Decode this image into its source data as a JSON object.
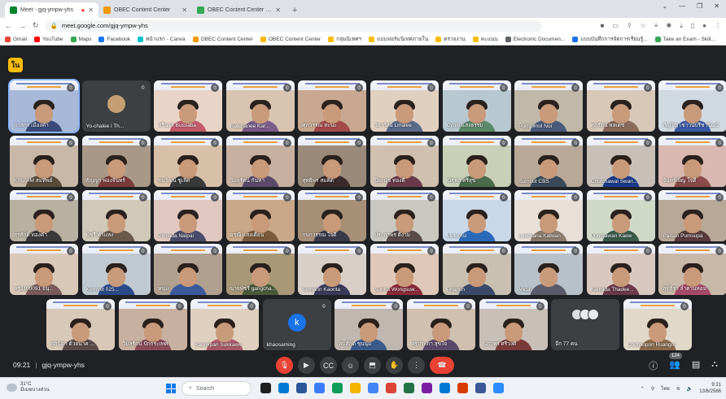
{
  "browser": {
    "tabs": [
      {
        "title": "Meet - gjq-ympw-yhs",
        "favicon_color": "#00832d",
        "active": true,
        "recording": true
      },
      {
        "title": "OBEC Content Center",
        "favicon_color": "#f29900",
        "active": false
      },
      {
        "title": "OBEC Content Center - OBEC",
        "favicon_color": "#34a853",
        "active": false
      }
    ],
    "newtab_label": "+",
    "url": "meet.google.com/gjq-ympw-yhs",
    "bookmarks": [
      {
        "label": "Gmail",
        "color": "#ea4335"
      },
      {
        "label": "YouTube",
        "color": "#ff0000"
      },
      {
        "label": "Maps",
        "color": "#34a853"
      },
      {
        "label": "Facebook",
        "color": "#1877f2"
      },
      {
        "label": "หน้าแรก - Canva",
        "color": "#00c4cc"
      },
      {
        "label": "OBEC Content Center",
        "color": "#f29900"
      },
      {
        "label": "OBEC Content Center",
        "color": "#fbbc04"
      },
      {
        "label": "กลุ่มนิเทศฯ",
        "color": "#fbbc04"
      },
      {
        "label": "แบบฟอร์มนิเทศภายใน",
        "color": "#fbbc04"
      },
      {
        "label": "ตรวจงาน",
        "color": "#fbbc04"
      },
      {
        "label": "คะแนน",
        "color": "#fbbc04"
      },
      {
        "label": "Electronic Documen...",
        "color": "#5f6368"
      },
      {
        "label": "แบบบันทึกการจัดการเรียนรู้...",
        "color": "#1a73e8"
      },
      {
        "label": "Take an Exam - Skill...",
        "color": "#34a853"
      }
    ]
  },
  "meet": {
    "host_badge": "ใน",
    "tiles": [
      {
        "name": "ภาสกร เมืองคำ",
        "kind": "video",
        "bg": "#a8b8d8",
        "body": "#3a4a7a",
        "selected": true
      },
      {
        "name": "Yo-chalee i Th...",
        "kind": "avatar",
        "bg": "#3c4043",
        "body": "#3c4043"
      },
      {
        "name": "ศรีนวล Bussaba",
        "kind": "video",
        "bg": "#e8d4c8",
        "body": "#c45a6a"
      },
      {
        "name": "Ratchanee Kar...",
        "kind": "video",
        "bg": "#d8c4b0",
        "body": "#7a5b8a"
      },
      {
        "name": "ศุภวรรณ ทะนะ",
        "kind": "video",
        "bg": "#c8a890",
        "body": "#a44a4a"
      },
      {
        "name": "วิลาวัลย์ Lmalee",
        "kind": "video",
        "bg": "#e0d0c0",
        "body": "#5a6a8a"
      },
      {
        "name": "Cynie แสงธรรม",
        "kind": "video",
        "bg": "#b8c8d0",
        "body": "#5a8a6a"
      },
      {
        "name": "Pornpimol Noi",
        "kind": "video",
        "bg": "#c0b8a8",
        "body": "#4a5a7a"
      },
      {
        "name": "ศุภรัตน์ พลเดช",
        "kind": "video",
        "bg": "#d8c8b8",
        "body": "#8a6a5a"
      },
      {
        "name": "ภิญโญ เชาวน์ปรีชาวัฒน์",
        "kind": "video",
        "bg": "#d0d8e0",
        "body": "#3a5aa8"
      },
      {
        "name": "KRU AM สมทิพย์",
        "kind": "video",
        "bg": "#c8b8a8",
        "body": "#5a4a3a"
      },
      {
        "name": "ธัญญา ฟองจันทร์",
        "kind": "video",
        "bg": "#a89888",
        "body": "#7a3a3a"
      },
      {
        "name": "ธนวัฒน์ ชูเลิศ",
        "kind": "video",
        "bg": "#d8c0a8",
        "body": "#3a3a3a"
      },
      {
        "name": "วิมลรัตน์ กันทา",
        "kind": "video",
        "bg": "#c8b0a0",
        "body": "#5a4a6a"
      },
      {
        "name": "สุทธิพร สมคิด",
        "kind": "video",
        "bg": "#9a8a7a",
        "body": "#3a2a2a"
      },
      {
        "name": "ปิยะนุช ทองดี",
        "kind": "video",
        "bg": "#d0c0b0",
        "body": "#6a3a4a"
      },
      {
        "name": "ณัฐพล ศรีสุข",
        "kind": "video",
        "bg": "#c8d0b8",
        "body": "#4a6a4a"
      },
      {
        "name": "Sombut CBS",
        "kind": "video",
        "bg": "#b8a898",
        "body": "#3a4a5a"
      },
      {
        "name": "Chutchawal Swan...",
        "kind": "video",
        "bg": "#c8c0b8",
        "body": "#1a3a8a"
      },
      {
        "name": "จันทร์เพ็ญ ใจดี",
        "kind": "video",
        "bg": "#d8b8b0",
        "body": "#8a4a4a"
      },
      {
        "name": "สุรศักดิ์ ทองคำ",
        "kind": "video",
        "bg": "#b8b0a0",
        "body": "#3a3a3a"
      },
      {
        "name": "พัชรี คำแหง",
        "kind": "video",
        "bg": "#d0c8b8",
        "body": "#6a5a4a"
      },
      {
        "name": "Pimlada Naipai",
        "kind": "video",
        "bg": "#e0c8c0",
        "body": "#4a4a6a"
      },
      {
        "name": "อรุณี แสงเดือน",
        "kind": "video",
        "bg": "#c8a888",
        "body": "#7a5a3a"
      },
      {
        "name": "กนกวรรณ ใจดี",
        "kind": "video",
        "bg": "#a89078",
        "body": "#3a3a4a"
      },
      {
        "name": "ประภาพร ดีงาม",
        "kind": "video",
        "bg": "#c8c8c0",
        "body": "#5a4a4a"
      },
      {
        "name": "Mutomsi",
        "kind": "video",
        "bg": "#c8d8e8",
        "body": "#2a6ab8"
      },
      {
        "name": "Lukchana Katwan",
        "kind": "video",
        "bg": "#e8e0d8",
        "body": "#8a7a6a"
      },
      {
        "name": "Pornsawan Kaew",
        "kind": "video",
        "bg": "#d0d8c8",
        "body": "#3a5a4a"
      },
      {
        "name": "Paisan Pumsupa",
        "kind": "video",
        "bg": "#b8a898",
        "body": "#5a3a3a"
      },
      {
        "name": "ครู2100091 อนุ...",
        "kind": "video",
        "bg": "#d8c8b8",
        "body": "#7a5a5a"
      },
      {
        "name": "Kornyot 025...",
        "kind": "video",
        "bg": "#c0c8d0",
        "body": "#2a4a8a"
      },
      {
        "name": "หนุ่ม",
        "kind": "video",
        "bg": "#b0a090",
        "body": "#3a5a9a"
      },
      {
        "name": "นายพัชรี gangcha...",
        "kind": "video",
        "bg": "#a89878",
        "body": "#4a5a3a"
      },
      {
        "name": "Sutharin Kaonta",
        "kind": "video",
        "bg": "#d8d0c8",
        "body": "#3a3a5a"
      },
      {
        "name": "Suntra Wongsuw...",
        "kind": "video",
        "bg": "#e0c8b8",
        "body": "#8a2a3a"
      },
      {
        "name": "Pirapon",
        "kind": "video",
        "bg": "#c8c0b0",
        "body": "#3a4a6a"
      },
      {
        "name": "Mida",
        "kind": "video",
        "bg": "#b8c0c8",
        "body": "#5a5a6a"
      },
      {
        "name": "Kannida Thadee...",
        "kind": "video",
        "bg": "#d8c8c0",
        "body": "#6a3a4a"
      },
      {
        "name": "สุทธิ์รา ลำดวนหอม",
        "kind": "video",
        "bg": "#c8b8a8",
        "body": "#a84a6a"
      },
      {
        "name": "ศุภนิดา ด้วยนาค ...",
        "kind": "video",
        "bg": "#d8c8b8",
        "body": "#5a4a4a"
      },
      {
        "name": "วิมลรัตน์ ปักกระเทศ",
        "kind": "video",
        "bg": "#c8b0a0",
        "body": "#8a4a5a"
      },
      {
        "name": "Kanokpan Sukkaew",
        "kind": "video",
        "bg": "#e0d0c0",
        "body": "#a85a6a"
      },
      {
        "name": "khaosaming",
        "kind": "initial",
        "initial": "k",
        "bg": "#3c4043",
        "body": "#3c4043"
      },
      {
        "name": "สมศักดิ์ ชุนนุ่ม",
        "kind": "video",
        "bg": "#c0b8b0",
        "body": "#3a5a8a"
      },
      {
        "name": "ครูประภา สุขใจ",
        "kind": "video",
        "bg": "#d0c0b0",
        "body": "#5a4a6a"
      },
      {
        "name": "นภาพร ศรีวงศ์",
        "kind": "video",
        "bg": "#c8c0b8",
        "body": "#7a3a3a"
      },
      {
        "name": "อีก 77 คน",
        "kind": "more",
        "bg": "#3c4043",
        "body": "#3c4043"
      },
      {
        "name": "Chutisopon Ruangrit",
        "kind": "self",
        "bg": "#e0d8c8",
        "body": "#8a6a4a"
      }
    ],
    "meeting_time": "09:21",
    "meeting_code": "gjq-ympw-yhs",
    "people_count": "124",
    "controls": [
      "mic-off",
      "camera",
      "captions",
      "emoji",
      "present",
      "raise-hand",
      "more",
      "leave-call"
    ]
  },
  "taskbar": {
    "weather_temp": "31°C",
    "weather_desc": "มีเมฆบางส่วน",
    "search_placeholder": "Search",
    "clock_time": "9:21",
    "clock_date": "13/6/2566",
    "lang": "ไทย",
    "app_colors": [
      "#1e1e1e",
      "#0078d4",
      "#2b579a",
      "#3c7dff",
      "#0f9d58",
      "#f4b400",
      "#4285f4",
      "#db4437",
      "#217346",
      "#7b1fa2",
      "#0078d4",
      "#d83b01",
      "#3b5998",
      "#2d8cff"
    ]
  }
}
